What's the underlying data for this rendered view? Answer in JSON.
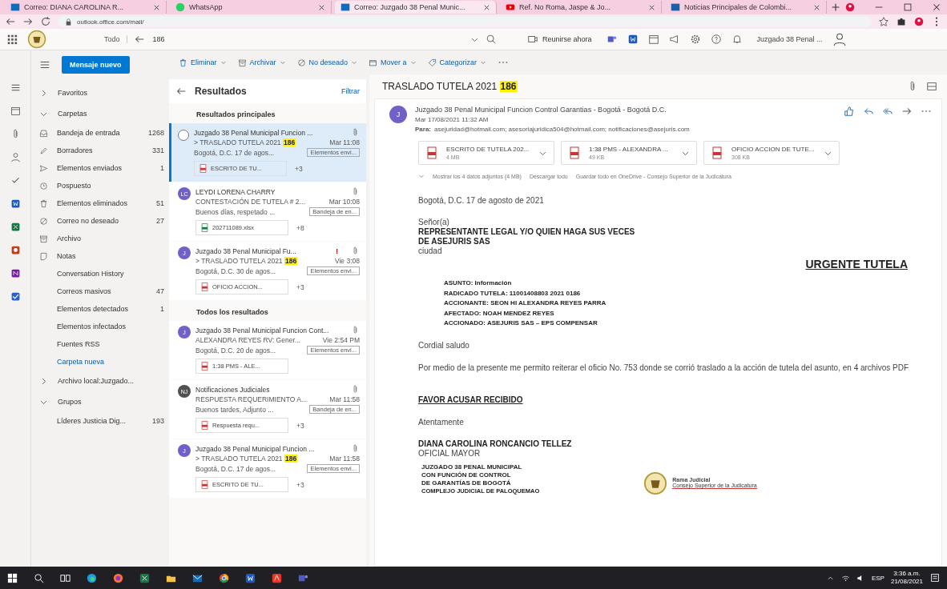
{
  "browser": {
    "tabs": [
      {
        "title": "Correo: DIANA CAROLINA R...",
        "kind": "mail",
        "selected": false
      },
      {
        "title": "WhatsApp",
        "kind": "chat",
        "selected": false
      },
      {
        "title": "Correo: Juzgado 38 Penal Munic...",
        "kind": "mail",
        "selected": true
      },
      {
        "title": "Ref. No Roma, Jaspe & Jo...",
        "kind": "video",
        "selected": false
      },
      {
        "title": "Noticias Principales de Colombi...",
        "kind": "news",
        "selected": false
      }
    ],
    "address": "outlook.office.com/mail/"
  },
  "header": {
    "filter": "Todo",
    "search_value": "186",
    "meet_now": "Reunirse ahora",
    "account": "Juzgado 38 Penal ..."
  },
  "commands": [
    {
      "label": "Eliminar",
      "kind": "delete"
    },
    {
      "label": "Archivar",
      "kind": "archive"
    },
    {
      "label": "No deseado",
      "kind": "junk"
    },
    {
      "label": "Mover a",
      "kind": "move"
    },
    {
      "label": "Categorizar",
      "kind": "tag"
    }
  ],
  "folder_pane": {
    "new_message": "Mensaje nuevo",
    "sections": [
      {
        "label": "Favoritos",
        "expanded": false
      },
      {
        "label": "Carpetas",
        "expanded": true,
        "items": [
          {
            "label": "Bandeja de entrada",
            "count": "1268",
            "kind": "inbox"
          },
          {
            "label": "Borradores",
            "count": "331",
            "kind": "drafts"
          },
          {
            "label": "Elementos enviados",
            "count": "1",
            "kind": "sent"
          },
          {
            "label": "Pospuesto",
            "kind": "snoozed"
          },
          {
            "label": "Elementos eliminados",
            "count": "51",
            "kind": "deleted"
          },
          {
            "label": "Correo no deseado",
            "count": "27",
            "kind": "junk"
          },
          {
            "label": "Archivo",
            "kind": "archive"
          },
          {
            "label": "Notas",
            "kind": "notes"
          },
          {
            "label": "Conversation History",
            "kind": "plain"
          },
          {
            "label": "Correos masivos",
            "count": "47",
            "kind": "plain"
          },
          {
            "label": "Elementos detectados",
            "count": "1",
            "kind": "plain"
          },
          {
            "label": "Elementos infectados",
            "kind": "plain"
          },
          {
            "label": "Fuentes RSS",
            "kind": "plain"
          },
          {
            "label": "Carpeta nueva",
            "kind": "link"
          }
        ]
      },
      {
        "label": "Archivo local:Juzgado...",
        "expanded": false
      },
      {
        "label": "Grupos",
        "expanded": true,
        "items": [
          {
            "label": "Líderes Justicia Dig...",
            "count": "193",
            "kind": "plain"
          }
        ]
      }
    ]
  },
  "message_list": {
    "title": "Resultados",
    "filter": "Filtrar",
    "groups": [
      {
        "label": "Resultados principales",
        "messages": [
          {
            "sender": "Juzgado 38 Penal Municipal Funcion ...",
            "selected": true,
            "subject": "> TRASLADO TUTELA 2021",
            "highlight": "186",
            "time": "Mar 11:08",
            "preview": "Bogotá, D.C. 17 de agos...",
            "category": "Elementos envi...",
            "attachment": {
              "name": "ESCRITO DE TU...",
              "kind": "pdf"
            },
            "more": "+3"
          },
          {
            "sender": "LEYDI LORENA CHARRY",
            "initials": "LC",
            "color": "#7160c8",
            "selected": false,
            "subject": "CONTESTACIÓN DE TUTELA # 2...",
            "time": "Mar 10:08",
            "preview": "Buenos días, respetado ...",
            "category": "Bandeja de en...",
            "attachment": {
              "name": "202711089.xlsx",
              "kind": "xlsx"
            },
            "more": "+8"
          },
          {
            "sender": "Juzgado 38 Penal Municipal Fu...",
            "initials": "J",
            "color": "#7160c8",
            "selected": false,
            "importance_mark": "!",
            "subject": "> TRASLADO TUTELA 2021",
            "highlight": "186",
            "time": "Vie 3:08",
            "preview": "Bogotá, D.C. 30 de agos...",
            "category": "Elementos envi...",
            "attachment": {
              "name": "OFICIO ACCION...",
              "kind": "pdf"
            },
            "more": "+3"
          }
        ]
      },
      {
        "label": "Todos los resultados",
        "messages": [
          {
            "sender": "Juzgado 38 Penal Municipal Funcion Cont...",
            "initials": "J",
            "color": "#7160c8",
            "selected": false,
            "subject": "ALEXANDRA REYES RV: Gener...",
            "time": "Vie 2:54 PM",
            "preview": "Bogotá, D.C. 20 de agos...",
            "category": "Elementos envi...",
            "attachment": {
              "name": "1:38 PMS - ALE...",
              "kind": "pdf"
            }
          },
          {
            "sender": "Notificaciones Judiciales",
            "initials": "NJ",
            "color": "#505050",
            "selected": false,
            "subject": "RESPUESTA REQUERIMIENTO A...",
            "time": "Mar 11:58",
            "preview": "Buenos tardes, Adjunto ...",
            "category": "Bandeja de en...",
            "attachment": {
              "name": "Respuesta requ...",
              "kind": "pdf"
            },
            "more": "+3"
          },
          {
            "sender": "Juzgado 38 Penal Municipal Funcion ...",
            "initials": "J",
            "color": "#7160c8",
            "selected": false,
            "subject": "> TRASLADO TUTELA 2021",
            "highlight": "186",
            "time": "Mar 11:58",
            "preview": "Bogotá, D.C. 17 de agos...",
            "category": "Elementos envi...",
            "attachment": {
              "name": "ESCRITO DE TU...",
              "kind": "pdf"
            },
            "more": "+3"
          }
        ]
      }
    ]
  },
  "reading_pane": {
    "subject": "TRASLADO TUTELA 2021",
    "subject_highlight": "186",
    "sender_initials": "J",
    "sender": "Juzgado 38 Penal Municipal Funcion Control Garantias - Bogotá - Bogotá D.C.",
    "date": "Mar 17/08/2021 11:32 AM",
    "to_label": "Para:",
    "to": "asejuridad@hotmail.com; asesoriajuridica504@hotmail.com; notificaciones@asejuris.com",
    "attachments": [
      {
        "name": "ESCRITO DE TUTELA 202...",
        "size": "4 MB"
      },
      {
        "name": "1:38 PMS - ALEXANDRA ...",
        "size": "49 KB"
      },
      {
        "name": "OFICIO ACCION DE TUTE...",
        "size": "308 KB"
      }
    ],
    "attachment_actions": [
      "Mostrar los 4 datos adjuntos (4 MB)",
      "Descargar todo",
      "Guardar todo en OneDrive - Consejo Superior de la Judicatura"
    ],
    "body": [
      {
        "kind": "text",
        "text": "Bogotá, D.C. 17 de agosto de 2021"
      },
      {
        "kind": "lines",
        "lines": [
          {
            "text": "Señor(a)",
            "bold": false
          },
          {
            "text": "REPRESENTANTE LEGAL Y/O QUIEN HAGA SUS VECES",
            "bold": true
          },
          {
            "text": "DE ASEJURIS SAS",
            "bold": true
          },
          {
            "text": "ciudad",
            "bold": false
          }
        ]
      },
      {
        "kind": "urgent",
        "text": "URGENTE TUTELA"
      },
      {
        "kind": "details",
        "lines": [
          "ASUNTO: Información",
          "RADICADO TUTELA: 11001408803 2021 0186",
          "ACCIONANTE: SEON HI ALEXANDRA REYES PARRA",
          "AFECTADO: NOAH MENDEZ REYES",
          "ACCIONADO: ASEJURIS SAS – EPS COMPENSAR"
        ]
      },
      {
        "kind": "text",
        "text": "Cordial saludo"
      },
      {
        "kind": "text",
        "text": "Por medio de la presente me permito reiterar el oficio No. 753 donde se corrió traslado a la acción de tutela del asunto, en 4 archivos PDF"
      },
      {
        "kind": "underline",
        "text": "FAVOR ACUSAR RECIBIDO"
      },
      {
        "kind": "text",
        "text": "Atentamente"
      },
      {
        "kind": "lines",
        "lines": [
          {
            "text": "DIANA CAROLINA RONCANCIO TELLEZ",
            "bold": true
          },
          {
            "text": "OFICIAL MAYOR",
            "bold": false
          }
        ]
      },
      {
        "kind": "signature",
        "lines": [
          "JUZGADO 38 PENAL MUNICIPAL",
          "CON FUNCIÓN DE CONTROL",
          "DE GARANTÍAS DE BOGOTÁ",
          "COMPLEJO JUDICIAL DE PALOQUEMAO"
        ],
        "logo_lines": [
          "Rama Judicial",
          "Consejo Superior de la Judicatura"
        ]
      }
    ]
  },
  "taskbar": {
    "apps": [
      {
        "kind": "start"
      },
      {
        "kind": "search"
      },
      {
        "kind": "taskview"
      },
      {
        "kind": "edge"
      },
      {
        "kind": "firefox"
      },
      {
        "kind": "excel"
      },
      {
        "kind": "file"
      },
      {
        "kind": "mail"
      },
      {
        "kind": "chrome"
      },
      {
        "kind": "word"
      },
      {
        "kind": "acrobat"
      },
      {
        "kind": "teams"
      }
    ],
    "language": "ESP",
    "time": "3:36 a.m.",
    "date": "21/08/2021"
  }
}
